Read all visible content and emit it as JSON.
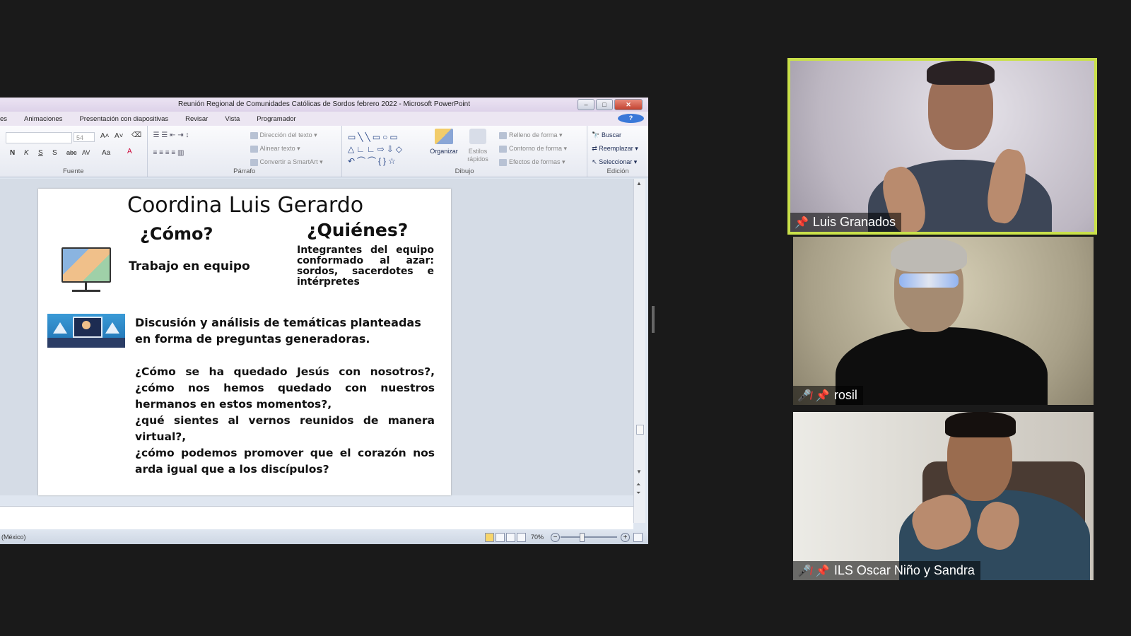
{
  "ppt": {
    "window_title": "Reunión Regional de Comunidades Católicas de Sordos febrero 2022  -  Microsoft PowerPoint",
    "tabs": [
      "es",
      "Animaciones",
      "Presentación con diapositivas",
      "Revisar",
      "Vista",
      "Programador"
    ],
    "font_size_value": "54",
    "groups": {
      "fuente": "Fuente",
      "parrafo": "Párrafo",
      "dibujo": "Dibujo",
      "edicion": "Edición"
    },
    "paragraph_buttons": {
      "direccion": "Dirección del texto",
      "alinear": "Alinear texto",
      "convertir": "Convertir a SmartArt"
    },
    "drawing_buttons": {
      "organizar": "Organizar",
      "estilos": "Estilos rápidos",
      "relleno": "Relleno de forma",
      "contorno": "Contorno de forma",
      "efectos": "Efectos de formas"
    },
    "editing_buttons": {
      "buscar": "Buscar",
      "reemplazar": "Reemplazar",
      "seleccionar": "Seleccionar"
    },
    "format_letters": [
      "N",
      "K",
      "S",
      "S",
      "abc",
      "AV",
      "Aa",
      "A"
    ],
    "status": {
      "language": "(México)",
      "zoom": "70%"
    }
  },
  "slide": {
    "title": "Coordina Luis Gerardo",
    "como": "¿Cómo?",
    "quienes": "¿Quiénes?",
    "trabajo": "Trabajo en equipo",
    "integrantes": "Integrantes del equipo conformado al azar: sordos, sacerdotes e intérpretes",
    "discusion": "Discusión y análisis de temáticas planteadas en forma de preguntas generadoras.",
    "preguntas": [
      "¿Cómo se ha quedado Jesús con nosotros?, ¿cómo nos hemos quedado con nuestros hermanos en estos momentos?,",
      "¿qué sientes al vernos reunidos de manera virtual?,",
      "¿cómo podemos promover que el corazón nos arda igual que a los discípulos?"
    ]
  },
  "participants": [
    {
      "name": "Luis Granados",
      "muted": false,
      "pinned": true,
      "active_speaker": true
    },
    {
      "name": "rosil",
      "muted": true,
      "pinned": true,
      "active_speaker": false
    },
    {
      "name": "ILS Oscar Niño y Sandra",
      "muted": true,
      "pinned": true,
      "active_speaker": false
    }
  ],
  "colors": {
    "active_speaker_border": "#c9e04a",
    "muted_icon": "#e23b3b",
    "background": "#1a1a1a"
  },
  "icons": {
    "pin": "pin-icon",
    "mic_muted": "mic-muted-icon"
  }
}
